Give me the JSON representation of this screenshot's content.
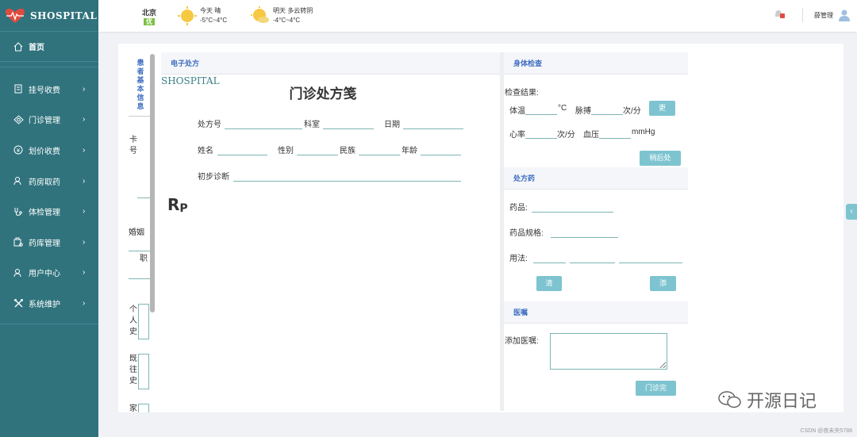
{
  "app": {
    "brand": "SHOSPITAL"
  },
  "sidebar": {
    "home": "首页",
    "items": [
      {
        "label": "挂号收费",
        "icon": "register-icon"
      },
      {
        "label": "门诊管理",
        "icon": "clinic-icon"
      },
      {
        "label": "划价收费",
        "icon": "pricing-icon"
      },
      {
        "label": "药房取药",
        "icon": "pharmacy-icon"
      },
      {
        "label": "体检管理",
        "icon": "checkup-icon"
      },
      {
        "label": "药库管理",
        "icon": "warehouse-icon"
      },
      {
        "label": "用户中心",
        "icon": "user-icon"
      },
      {
        "label": "系统维护",
        "icon": "tools-icon"
      }
    ]
  },
  "topbar": {
    "city": "北京",
    "aqi": "优",
    "today": {
      "label": "今天",
      "weather": "晴",
      "temp": "-5°C~4°C"
    },
    "tomorrow": {
      "label": "明天",
      "weather": "多云转阴",
      "temp": "-4°C~4°C"
    },
    "user": "薛管理"
  },
  "patient_info": {
    "title": "患者基本信息",
    "card_label": "卡号",
    "marriage_label": "婚姻",
    "job_label": "职",
    "personal_history": "个人史",
    "past_history": "既往史",
    "family_history": "家"
  },
  "prescription": {
    "panel_title": "电子处方",
    "brand": "SHOSPITAL",
    "title": "门诊处方笺",
    "fields": {
      "rx_no": "处方号",
      "department": "科室",
      "date": "日期",
      "name": "姓名",
      "gender": "性别",
      "ethnicity": "民族",
      "age": "年龄",
      "diagnosis": "初步诊断"
    },
    "rp": "R",
    "rp_sub": "P"
  },
  "exam": {
    "title": "身体检查",
    "result_label": "检查结果:",
    "temp_label": "体温",
    "temp_unit": "°C",
    "pulse_label": "脉搏",
    "pulse_unit": "次/分",
    "update_btn": "更",
    "heart_label": "心率",
    "heart_unit": "次/分",
    "bp_label": "血压",
    "bp_unit": "mmHg",
    "later_btn": "稍后处"
  },
  "medicine": {
    "title": "处方药",
    "drug_label": "药品:",
    "spec_label": "药品规格:",
    "usage_label": "用法:",
    "clear_btn": "清",
    "add_btn": "添"
  },
  "advice": {
    "title": "医嘱",
    "add_label": "添加医嘱:",
    "finish_btn": "门诊完"
  },
  "watermark": {
    "text": "开源日记"
  },
  "credit": "CSDN @夜未央5788"
}
